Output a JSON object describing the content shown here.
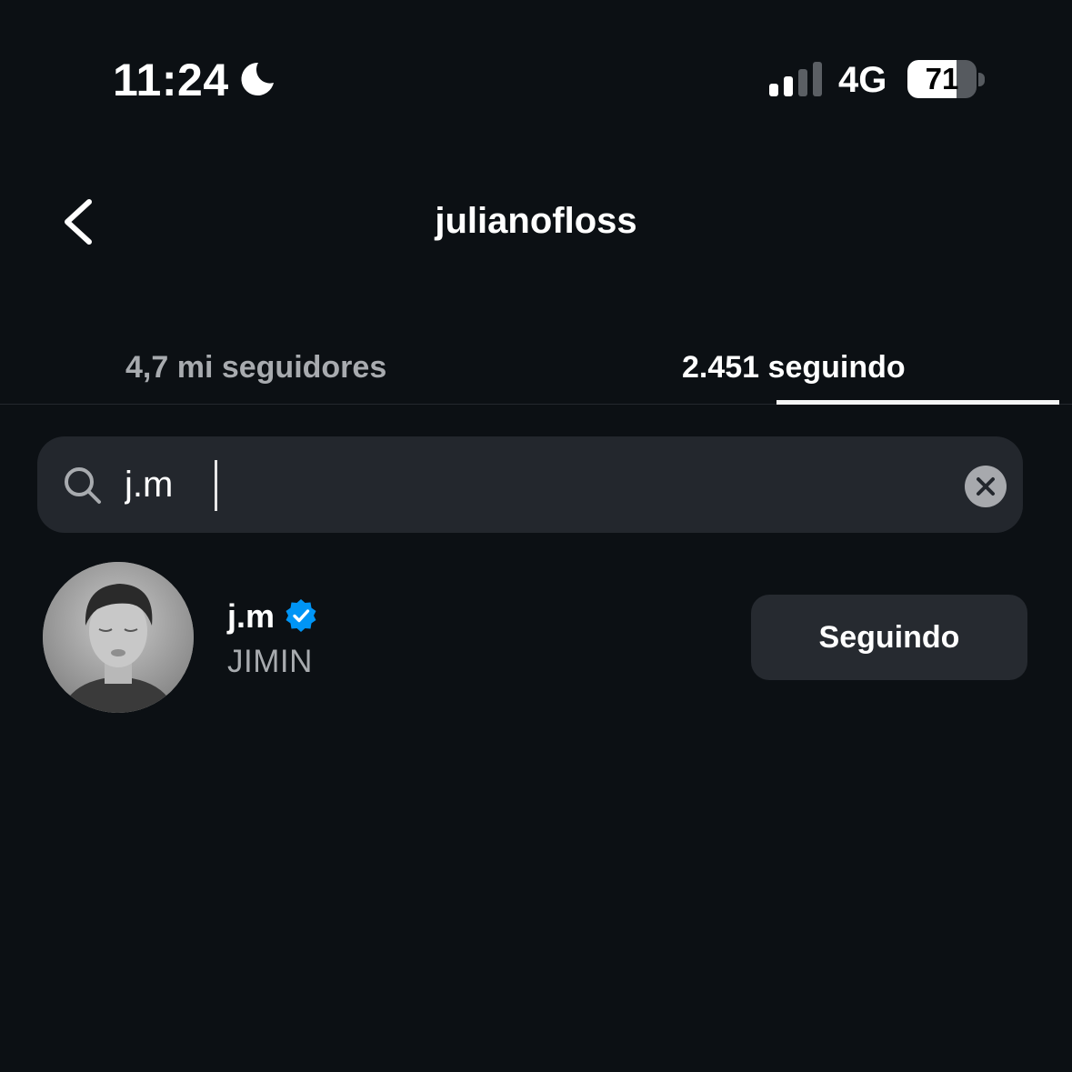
{
  "status_bar": {
    "time": "11:24",
    "focus_icon": "moon-icon",
    "network": "4G",
    "battery": "71",
    "battery_level": 0.71
  },
  "header": {
    "back_icon": "chevron-left-icon",
    "title": "julianofloss"
  },
  "tabs": [
    {
      "label": "4,7 mi seguidores",
      "active": false
    },
    {
      "label": "2.451 seguindo",
      "active": true
    }
  ],
  "search": {
    "icon": "search-icon",
    "value": "j.m",
    "clear_icon": "close-circle-icon"
  },
  "results": [
    {
      "username": "j.m",
      "verified": true,
      "full_name": "JIMIN",
      "button_label": "Seguindo"
    }
  ],
  "colors": {
    "background": "#0c1014",
    "verified_blue": "#0095f6",
    "button_bg": "#262a30"
  }
}
